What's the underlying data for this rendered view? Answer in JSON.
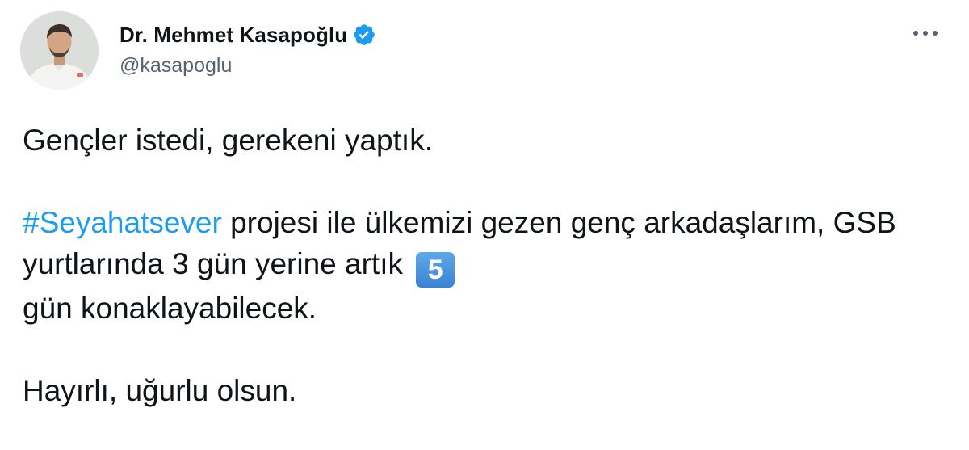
{
  "author": {
    "display_name": "Dr. Mehmet Kasapoğlu",
    "handle": "@kasapoglu",
    "verified": true,
    "verified_color": "#1d9bf0"
  },
  "menu": {
    "icon": "more-horizontal-icon"
  },
  "tweet": {
    "line1": "Gençler istedi, gerekeni yaptık.",
    "hashtag": "#Seyahatsever",
    "para2_part1": " projesi ile ülkemizi gezen genç arkadaşlarım, GSB yurtlarında 3 gün yerine artık ",
    "keycap": "5",
    "para2_part2": " gün konaklayabilecek.",
    "line3": "Hayırlı, uğurlu olsun.",
    "hashtag_color": "#1d9bf0"
  }
}
